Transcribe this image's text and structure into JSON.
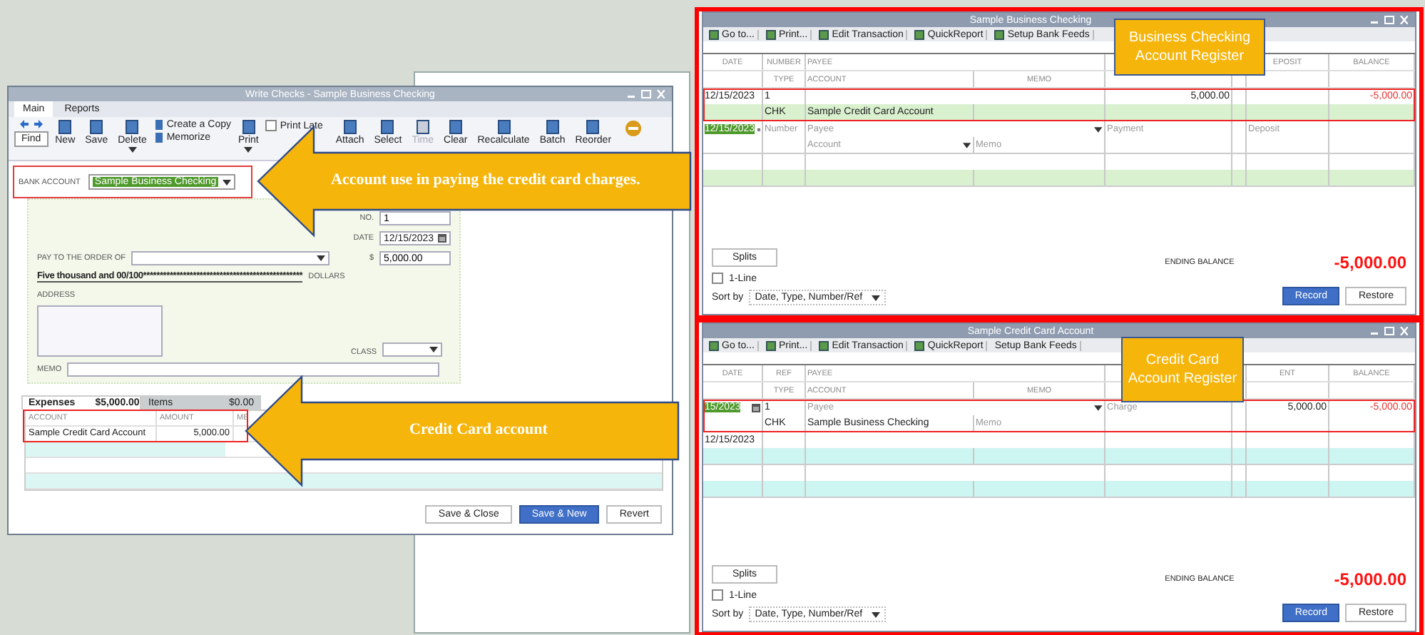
{
  "write_checks": {
    "title": "Write Checks - Sample Business Checking",
    "tabs": [
      {
        "label": "Main",
        "selected": true
      },
      {
        "label": "Reports",
        "selected": false
      }
    ],
    "toolbar": [
      {
        "label": "Find",
        "kind": "find",
        "disabled": false,
        "menu": false
      },
      {
        "label": "New",
        "kind": "large",
        "disabled": false,
        "menu": false
      },
      {
        "label": "Save",
        "kind": "large",
        "disabled": false,
        "menu": false
      },
      {
        "label": "Delete",
        "kind": "large",
        "disabled": false,
        "menu": true
      },
      {
        "label": "Create a Copy",
        "kind": "small",
        "disabled": false,
        "menu": false
      },
      {
        "label": "Memorize",
        "kind": "small",
        "disabled": false,
        "menu": false
      },
      {
        "label": "Print",
        "kind": "large",
        "disabled": false,
        "menu": true
      },
      {
        "label": "Print Late",
        "kind": "checkbox",
        "checked": false,
        "disabled": false,
        "menu": false
      },
      {
        "label": "Attach",
        "kind": "large",
        "disabled": false,
        "menu": false
      },
      {
        "label": "Select",
        "kind": "large",
        "disabled": false,
        "menu": false
      },
      {
        "label": "Time",
        "kind": "large",
        "disabled": true,
        "menu": false
      },
      {
        "label": "Clear",
        "kind": "large",
        "disabled": false,
        "menu": false
      },
      {
        "label": "Recalculate",
        "kind": "large",
        "disabled": false,
        "menu": false
      },
      {
        "label": "Batch",
        "kind": "large",
        "disabled": false,
        "menu": false
      },
      {
        "label": "Reorder",
        "kind": "large",
        "disabled": false,
        "menu": false
      }
    ],
    "bank_account": {
      "label": "BANK ACCOUNT",
      "value": "Sample Business Checking",
      "highlighted": true
    },
    "check": {
      "number_label": "NO.",
      "number": "1",
      "date_label": "DATE",
      "date": "12/15/2023",
      "payee_label": "PAY TO THE ORDER OF",
      "amount_label": "$",
      "amount": "5,000.00",
      "amount_words": "Five thousand  and 00/100************************************************",
      "dollars_label": "DOLLARS",
      "address_label": "ADDRESS",
      "class_label": "CLASS",
      "memo_label": "MEMO"
    },
    "detail_tabs": [
      {
        "label": "Expenses",
        "amount": "$5,000.00",
        "selected": true
      },
      {
        "label": "Items",
        "amount": "$0.00",
        "selected": false
      }
    ],
    "detail_table": {
      "columns": [
        "ACCOUNT",
        "AMOUNT",
        "ME"
      ],
      "highlighted": true,
      "rows": [
        {
          "account": "Sample Credit Card Account",
          "amount": "5,000.00"
        }
      ]
    },
    "buttons": [
      {
        "label": "Save & Close",
        "primary": false
      },
      {
        "label": "Save & New",
        "primary": true
      },
      {
        "label": "Revert",
        "primary": false
      }
    ]
  },
  "callouts": [
    {
      "text": "Account use in paying the credit card charges."
    },
    {
      "text": "Credit Card account"
    }
  ],
  "registers": [
    {
      "title": "Sample Business Checking",
      "label": "Business Checking Account Register",
      "color": "#d9f1cf",
      "toolbar": [
        {
          "label": "Go to...",
          "icon": true
        },
        {
          "label": "Print...",
          "icon": true
        },
        {
          "label": "Edit Transaction",
          "icon": true
        },
        {
          "label": "QuickReport",
          "icon": true
        },
        {
          "label": "Setup Bank Feeds",
          "icon": true
        }
      ],
      "header_top": {
        "column_1": "DATE",
        "column_2": "NUMBER",
        "column_3": "PAYEE",
        "column_7": "EPOSIT",
        "column_8": "BALANCE"
      },
      "header_bottom": {
        "column_2": "TYPE",
        "column_3": "ACCOUNT",
        "column_4": "MEMO"
      },
      "rows": [
        {
          "kind": "transaction",
          "highlighted": true,
          "line1": {
            "column_1": "12/15/2023",
            "column_2": "1",
            "column_5": "5,000.00",
            "column_8": "-5,000.00"
          },
          "line2": {
            "column_2": "CHK",
            "column_3": "Sample Credit Card Account"
          }
        },
        {
          "kind": "entry",
          "highlighted": false,
          "line1": {
            "column_1": {
              "value": "12/15/2023",
              "selected": true
            },
            "column_2": {
              "placeholder": "Number"
            },
            "column_3": {
              "placeholder": "Payee"
            },
            "column_5": {
              "placeholder": "Payment"
            },
            "column_7": {
              "placeholder": "Deposit"
            }
          },
          "line2": {
            "column_3": {
              "placeholder": "Account"
            },
            "column_4": {
              "placeholder": "Memo"
            }
          }
        },
        {
          "kind": "blank",
          "highlighted": false
        }
      ],
      "splits": "Splits",
      "one_line": {
        "label": "1-Line",
        "checked": false
      },
      "sort_label": "Sort by",
      "sort_value": "Date, Type, Number/Ref",
      "ending_balance_label": "ENDING BALANCE",
      "ending_balance": "-5,000.00",
      "buttons": [
        {
          "label": "Record",
          "primary": true
        },
        {
          "label": "Restore",
          "primary": false
        }
      ]
    },
    {
      "title": "Sample Credit Card Account",
      "label": "Credit Card Account Register",
      "color": "#cdf5f1",
      "toolbar": [
        {
          "label": "Go to...",
          "icon": true
        },
        {
          "label": "Print...",
          "icon": true
        },
        {
          "label": "Edit Transaction",
          "icon": true
        },
        {
          "label": "QuickReport",
          "icon": true
        },
        {
          "label": "Setup Bank Feeds",
          "icon": false
        }
      ],
      "header_top": {
        "column_1": "DATE",
        "column_2": "REF",
        "column_3": "PAYEE",
        "column_7": "ENT",
        "column_8": "BALANCE"
      },
      "header_bottom": {
        "column_2": "TYPE",
        "column_3": "ACCOUNT",
        "column_4": "MEMO"
      },
      "rows": [
        {
          "kind": "entry",
          "highlighted": true,
          "line1": {
            "column_1": {
              "value": "15/2023",
              "selected": true
            },
            "column_2": "1",
            "column_3": {
              "placeholder": "Payee"
            },
            "column_5": {
              "placeholder": "Charge"
            },
            "column_7": "5,000.00",
            "column_8": "-5,000.00"
          },
          "line2": {
            "column_2": "CHK",
            "column_3": "Sample Business Checking",
            "column_4": {
              "placeholder": "Memo"
            }
          }
        },
        {
          "kind": "transaction",
          "highlighted": false,
          "line1": {
            "column_1": "12/15/2023"
          },
          "line2": {}
        },
        {
          "kind": "blank",
          "highlighted": false
        }
      ],
      "splits": "Splits",
      "one_line": {
        "label": "1-Line",
        "checked": false
      },
      "sort_label": "Sort by",
      "sort_value": "Date, Type, Number/Ref",
      "ending_balance_label": "ENDING BALANCE",
      "ending_balance": "-5,000.00",
      "buttons": [
        {
          "label": "Record",
          "primary": true
        },
        {
          "label": "Restore",
          "primary": false
        }
      ]
    }
  ]
}
